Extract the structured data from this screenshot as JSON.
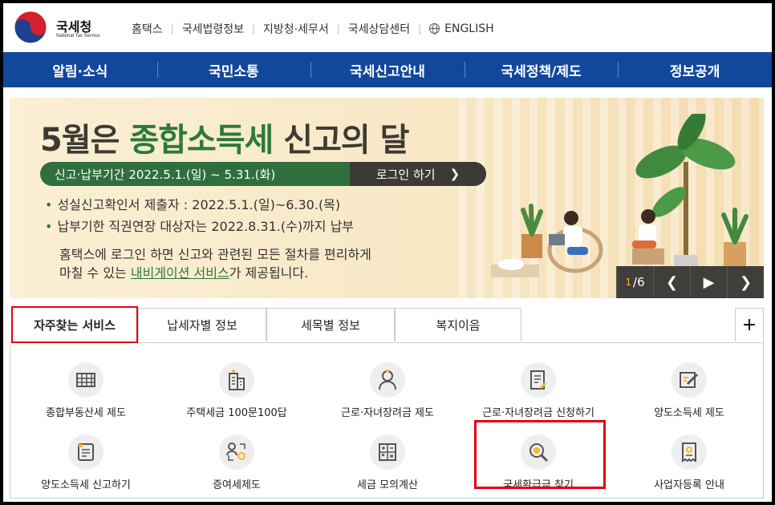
{
  "header": {
    "logo_text": "국세청",
    "logo_sub": "National Tax Service",
    "links": [
      "홈택스",
      "국세법령정보",
      "지방청·세무서",
      "국세상담센터",
      "ENGLISH"
    ]
  },
  "gnb": [
    "알림·소식",
    "국민소통",
    "국세신고안내",
    "국세정책/제도",
    "정보공개"
  ],
  "banner": {
    "title_pre": "5월은 ",
    "title_hl": "종합소득세",
    "title_post": " 신고의 달",
    "period": "신고·납부기간   2022.5.1.(일) ~ 5.31.(화)",
    "login": "로그인 하기",
    "bullet1": "성실신고확인서 제출자 : 2022.5.1.(일)~6.30.(목)",
    "bullet2": "납부기한 직권연장 대상자는 2022.8.31.(수)까지 납부",
    "desc_line1": "홈택스에 로그인 하면 신고와 관련된 모든 절차를 편리하게",
    "desc_line2_pre": "마칠 수 있는 ",
    "desc_link": "내비게이션 서비스",
    "desc_line2_post": "가 제공됩니다.",
    "pager_current": "1",
    "pager_total": "/6"
  },
  "tabs": [
    "자주찾는 서비스",
    "납세자별 정보",
    "세목별 정보",
    "복지이음"
  ],
  "services": [
    {
      "label": "종합부동산세 제도",
      "icon": "building-doc-icon"
    },
    {
      "label": "주택세금 100문100답",
      "icon": "apartment-icon"
    },
    {
      "label": "근로·자녀장려금 제도",
      "icon": "person-icon"
    },
    {
      "label": "근로·자녀장려금 신청하기",
      "icon": "document-pen-icon"
    },
    {
      "label": "양도소득세 제도",
      "icon": "edit-doc-icon"
    },
    {
      "label": "양도소득세 신고하기",
      "icon": "form-icon"
    },
    {
      "label": "증여세제도",
      "icon": "transfer-people-icon"
    },
    {
      "label": "세금 모의계산",
      "icon": "calculator-icon"
    },
    {
      "label": "국세환급금 찾기",
      "icon": "magnifier-won-icon"
    },
    {
      "label": "사업자등록 안내",
      "icon": "receipt-icon"
    }
  ],
  "colors": {
    "gnb": "#12489c",
    "accent_green": "#2c7a3a",
    "highlight_red": "#e60012"
  }
}
